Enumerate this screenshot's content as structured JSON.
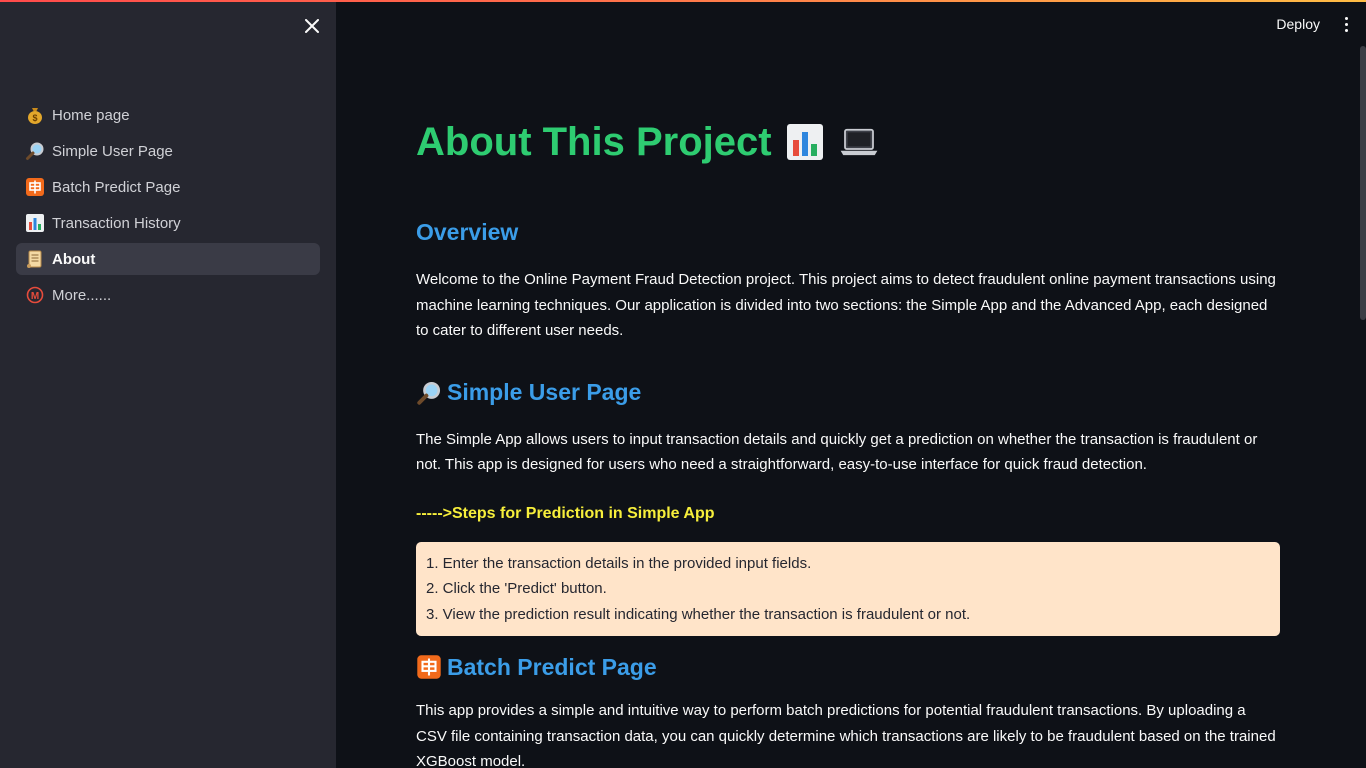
{
  "header": {
    "deploy_label": "Deploy"
  },
  "sidebar": {
    "items": [
      {
        "label": "Home page",
        "icon": "money-bag-icon",
        "active": false
      },
      {
        "label": "Simple User Page",
        "icon": "magnifier-icon",
        "active": false
      },
      {
        "label": "Batch Predict Page",
        "icon": "batch-icon",
        "active": false
      },
      {
        "label": "Transaction History",
        "icon": "bar-chart-icon",
        "active": false
      },
      {
        "label": "About",
        "icon": "scroll-icon",
        "active": true
      },
      {
        "label": "More......",
        "icon": "circled-m-icon",
        "active": false
      }
    ]
  },
  "main": {
    "title": "About This Project",
    "overview": {
      "heading": "Overview",
      "text": "Welcome to the Online Payment Fraud Detection project. This project aims to detect fraudulent online payment transactions using machine learning techniques. Our application is divided into two sections: the Simple App and the Advanced App, each designed to cater to different user needs."
    },
    "simple": {
      "heading": "Simple User Page",
      "text": "The Simple App allows users to input transaction details and quickly get a prediction on whether the transaction is fraudulent or not. This app is designed for users who need a straightforward, easy-to-use interface for quick fraud detection.",
      "steps_heading": "----->Steps for Prediction in Simple App",
      "steps": [
        "1. Enter the transaction details in the provided input fields.",
        "2. Click the 'Predict' button.",
        "3. View the prediction result indicating whether the transaction is fraudulent or not."
      ]
    },
    "batch": {
      "heading": "Batch Predict Page",
      "text": "This app provides a simple and intuitive way to perform batch predictions for potential fraudulent transactions. By uploading a CSV file containing transaction data, you can quickly determine which transactions are likely to be fraudulent based on the trained XGBoost model."
    }
  },
  "colors": {
    "title": "#2ecc71",
    "section_heading": "#3b9de8",
    "steps_heading": "#f7ef3b",
    "steps_box": "#ffe4c9",
    "sidebar_bg": "#262730",
    "main_bg": "#0e1117"
  }
}
